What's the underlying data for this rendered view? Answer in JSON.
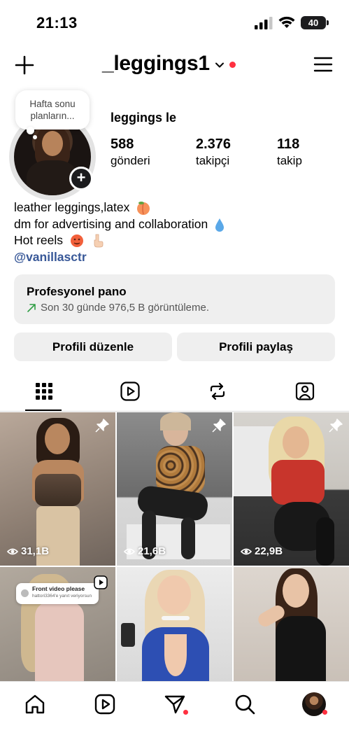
{
  "status_bar": {
    "time": "21:13",
    "battery": "40"
  },
  "header": {
    "username": "_leggings1"
  },
  "profile": {
    "note": "Hafta sonu planların...",
    "display_name": "leggings le",
    "stats": [
      {
        "value": "588",
        "label": "gönderi"
      },
      {
        "value": "2.376",
        "label": "takipçi"
      },
      {
        "value": "118",
        "label": "takip"
      }
    ],
    "bio": {
      "line1": "leather leggings,latex",
      "line2": "dm for advertising and collaboration",
      "line3": "Hot reels",
      "link": "@vanillasctr"
    }
  },
  "dashboard": {
    "title": "Profesyonel pano",
    "subtitle": "Son 30 günde 976,5 B görüntüleme."
  },
  "buttons": {
    "edit": "Profili düzenle",
    "share": "Profili paylaş"
  },
  "tabs": [
    "grid-icon",
    "reels-icon",
    "reposts-icon",
    "tagged-icon"
  ],
  "grid": {
    "posts": [
      {
        "views": "31,1B",
        "pinned": true
      },
      {
        "views": "21,6B",
        "pinned": true
      },
      {
        "views": "22,9B",
        "pinned": true
      },
      {
        "views": ""
      },
      {
        "views": ""
      },
      {
        "views": ""
      }
    ],
    "reply_card": {
      "title": "Front video please",
      "subtitle": "hattori3364'e yanıt veriyorsun"
    }
  },
  "colors": {
    "accent_red": "#ff3040",
    "link": "#385898",
    "button_bg": "#efefef"
  }
}
